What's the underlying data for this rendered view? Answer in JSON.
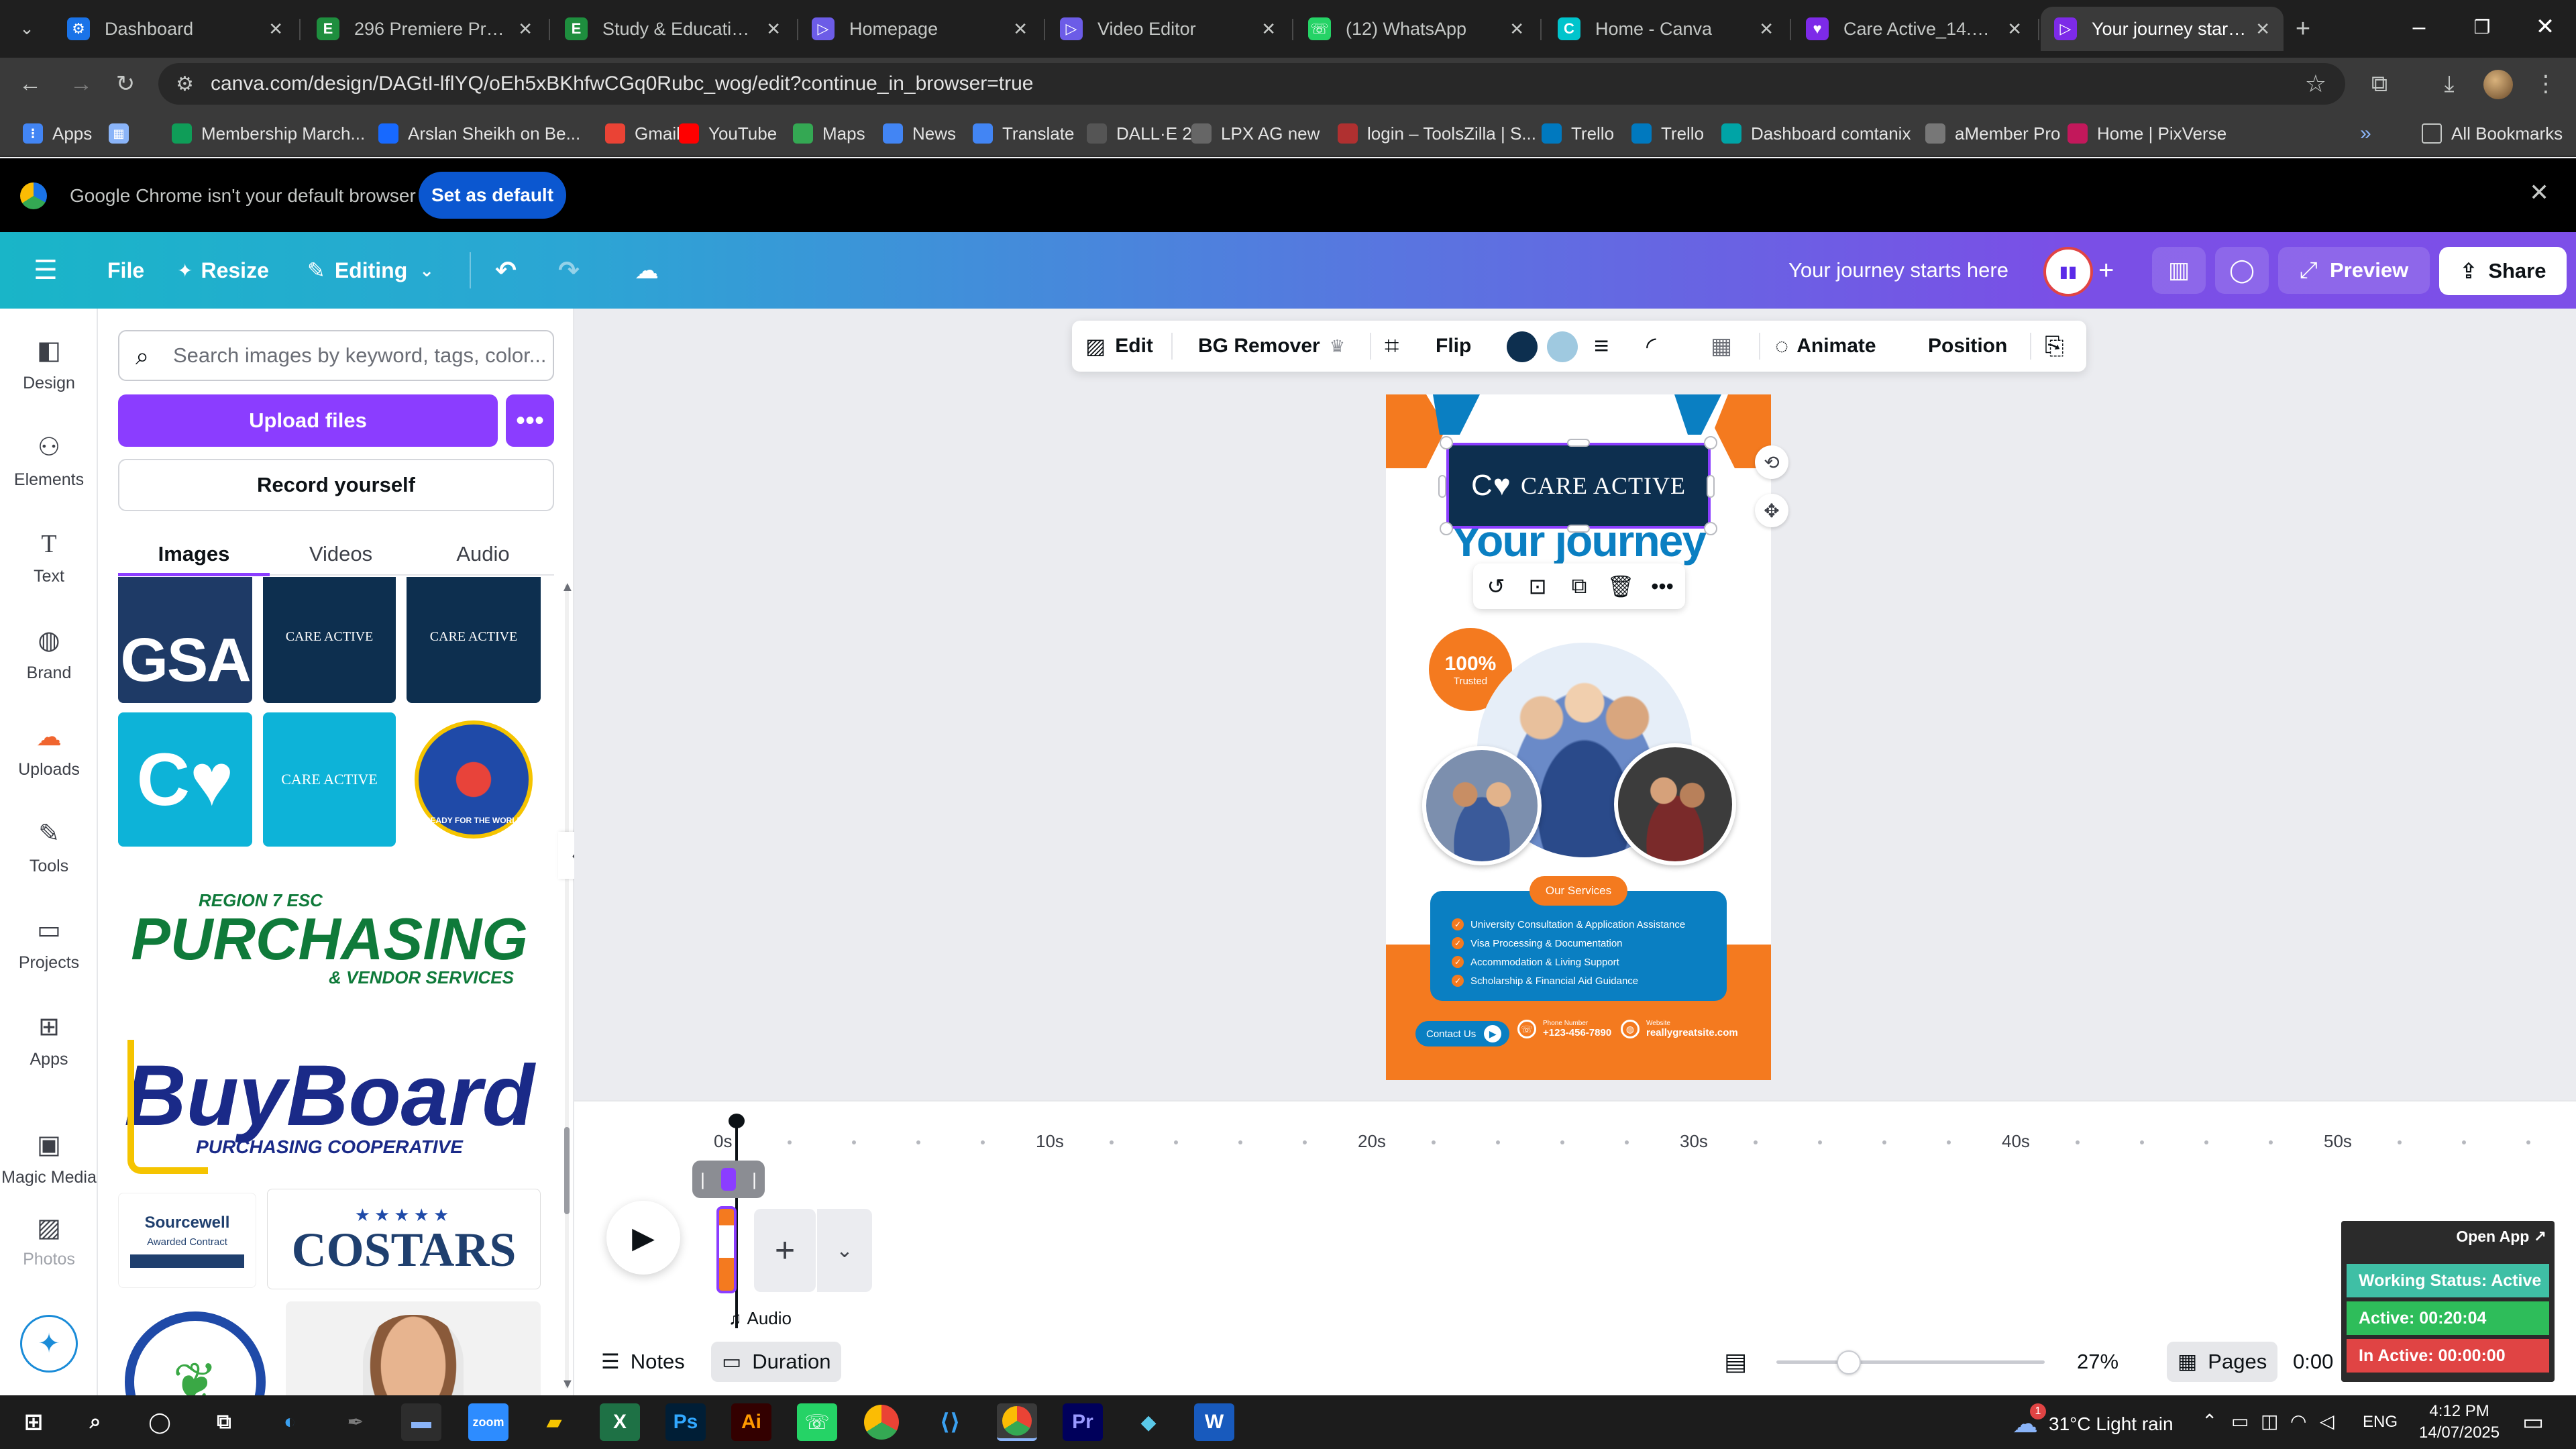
{
  "browser": {
    "tabs": [
      {
        "title": "Dashboard",
        "favicon_color": "#1a73e8",
        "favicon": "gear-icon"
      },
      {
        "title": "296 Premiere Pro Stu",
        "favicon_color": "#1e8e3e",
        "favicon": "E"
      },
      {
        "title": "Study & Education Sl",
        "favicon_color": "#1e8e3e",
        "favicon": "E"
      },
      {
        "title": "Homepage",
        "favicon_color": "#6c5ce7",
        "favicon": "▷"
      },
      {
        "title": "Video Editor",
        "favicon_color": "#6c5ce7",
        "favicon": "▷"
      },
      {
        "title": "(12) WhatsApp",
        "favicon_color": "#25d366",
        "favicon": "☏"
      },
      {
        "title": "Home - Canva",
        "favicon_color": "#00c4cc",
        "favicon": "C"
      },
      {
        "title": "Care Active_14.7.25 (",
        "favicon_color": "#7d2ae8",
        "favicon": "♥"
      },
      {
        "title": "Your journey starts he",
        "favicon_color": "#7d2ae8",
        "favicon": "▷"
      }
    ],
    "new_tab": "+",
    "url": "canva.com/design/DAGtI-lflYQ/oEh5xBKhfwCGq0Rubc_wog/edit?continue_in_browser=true",
    "bookmarks": [
      {
        "label": "Apps",
        "color": "#4285f4"
      },
      {
        "label": "",
        "color": "#8ab4f8"
      },
      {
        "label": "Membership March...",
        "color": "#0f9d58"
      },
      {
        "label": "Arslan Sheikh on Be...",
        "color": "#1769ff"
      },
      {
        "label": "Gmail",
        "color": "#ea4335"
      },
      {
        "label": "YouTube",
        "color": "#ff0000"
      },
      {
        "label": "Maps",
        "color": "#34a853"
      },
      {
        "label": "News",
        "color": "#4285f4"
      },
      {
        "label": "Translate",
        "color": "#4285f4"
      },
      {
        "label": "DALL·E 2",
        "color": "#555555"
      },
      {
        "label": "LPX AG new",
        "color": "#666666"
      },
      {
        "label": "login – ToolsZilla | S...",
        "color": "#b03030"
      },
      {
        "label": "Trello",
        "color": "#0079bf"
      },
      {
        "label": "Trello",
        "color": "#0079bf"
      },
      {
        "label": "Dashboard comtanix",
        "color": "#00a4a6"
      },
      {
        "label": "aMember Pro",
        "color": "#777777"
      },
      {
        "label": "Home | PixVerse",
        "color": "#c2185b"
      }
    ],
    "all_bookmarks": "All Bookmarks",
    "default_notice": "Google Chrome isn't your default browser",
    "set_default": "Set as default"
  },
  "canva": {
    "menu": {
      "file": "File",
      "resize": "Resize",
      "editing": "Editing"
    },
    "design_title": "Your journey starts here",
    "preview": "Preview",
    "share": "Share",
    "rail": [
      "Design",
      "Elements",
      "Text",
      "Brand",
      "Uploads",
      "Tools",
      "Projects",
      "Apps",
      "Magic Media",
      "Photos"
    ],
    "panel": {
      "search_placeholder": "Search images by keyword, tags, color...",
      "upload": "Upload files",
      "record": "Record yourself",
      "tabs": [
        "Images",
        "Videos",
        "Audio"
      ],
      "tiles": {
        "gsa": "GSA",
        "care_active": "CARE ACTIVE",
        "region": "REGION 7 ESC",
        "purchasing": "PURCHASING",
        "vendor": "& VENDOR SERVICES",
        "buyboard": "BuyBoard",
        "coop": "PURCHASING COOPERATIVE",
        "sourcewell": "Sourcewell",
        "awarded": "Awarded Contract",
        "costars": "COSTARS",
        "la_text": "READY FOR THE WORLD"
      }
    },
    "toolbar": {
      "edit": "Edit",
      "bg_remover": "BG Remover",
      "flip": "Flip",
      "color1": "#0d2f4f",
      "color2": "#9fc9e0",
      "animate": "Animate",
      "position": "Position"
    },
    "design": {
      "logo_text": "CARE ACTIVE",
      "headline": "Your journey",
      "badge_big": "100%",
      "badge_small": "Trusted",
      "services_title": "Our Services",
      "services": [
        "University Consultation & Application Assistance",
        "Visa Processing & Documentation",
        "Accommodation & Living Support",
        "Scholarship & Financial Aid Guidance"
      ],
      "contact": "Contact Us",
      "phone_label": "Phone Number",
      "phone": "+123-456-7890",
      "website_label": "Website",
      "website": "reallygreatsite.com",
      "orange": "#f47a1f",
      "blue": "#0a7fc2"
    },
    "timeline": {
      "ticks": [
        "0s",
        "10s",
        "20s",
        "30s",
        "40s",
        "50s"
      ],
      "audio": "Audio"
    },
    "footer": {
      "notes": "Notes",
      "duration": "Duration",
      "zoom": "27%",
      "pages": "Pages",
      "time": "0:00",
      "time2": "0:00"
    }
  },
  "widget": {
    "open_app": "Open App ↗",
    "working": "Working Status: Active",
    "active": "Active: 00:20:04",
    "inactive": "In Active: 00:00:00"
  },
  "taskbar": {
    "weather": "31°C  Light rain",
    "lang": "ENG",
    "time": "4:12 PM",
    "date": "14/07/2025",
    "notif": "1"
  }
}
